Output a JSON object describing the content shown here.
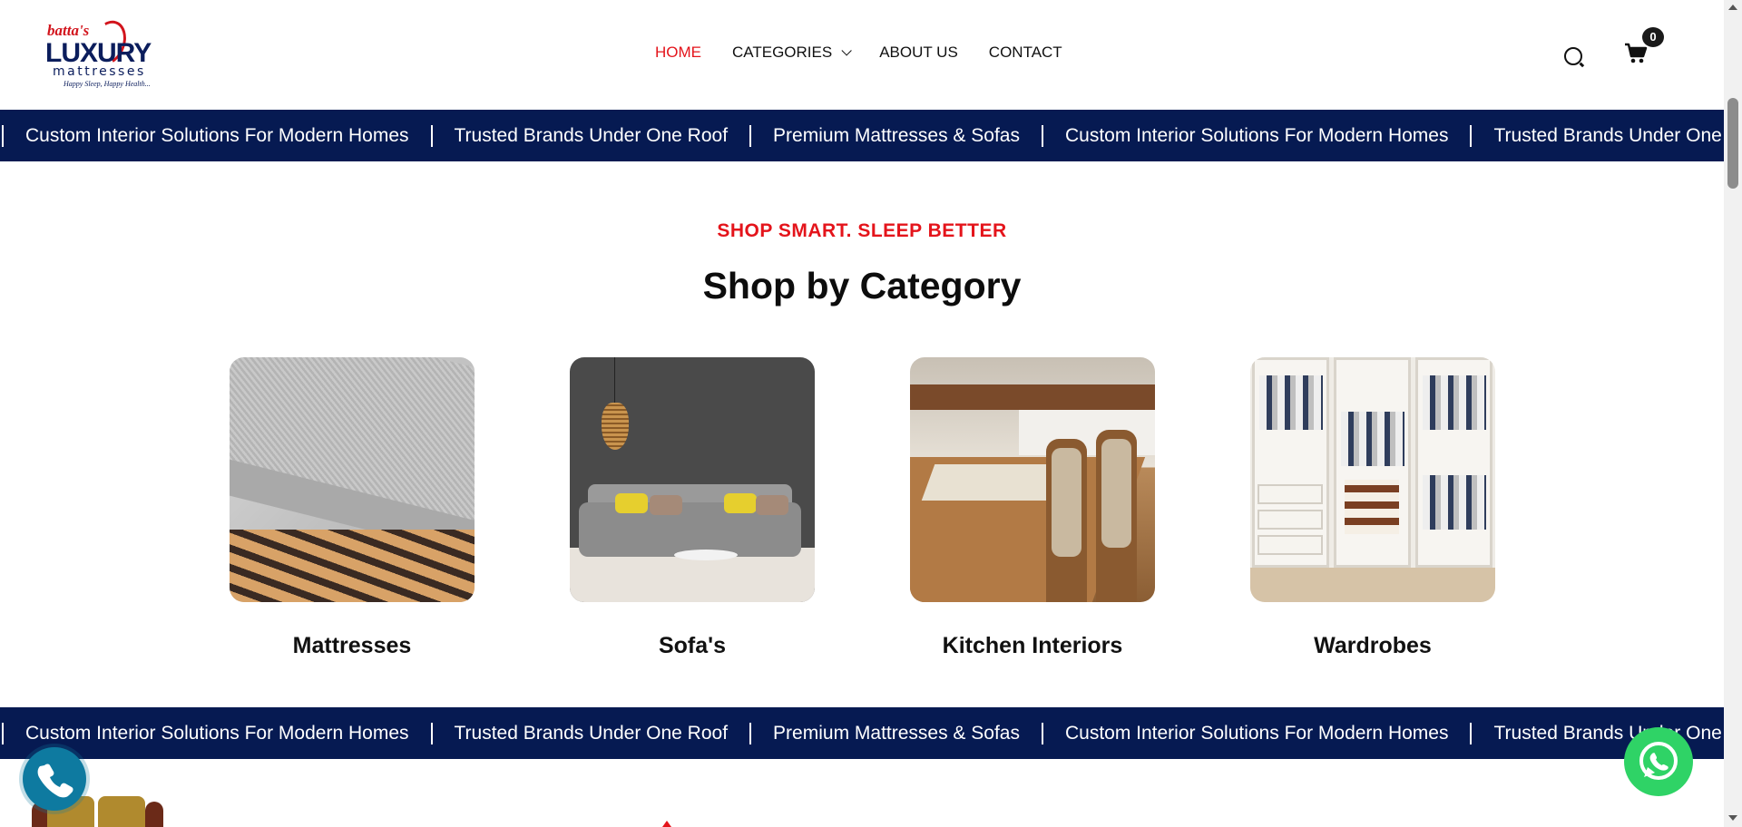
{
  "header": {
    "logo": {
      "line1": "batta's",
      "line2": "LUXURY",
      "line3": "mattresses",
      "tagline": "Happy Sleep, Happy Health..."
    },
    "nav": [
      {
        "label": "HOME",
        "active": true
      },
      {
        "label": "CATEGORIES",
        "has_dropdown": true
      },
      {
        "label": "ABOUT US"
      },
      {
        "label": "CONTACT"
      }
    ],
    "cart_count": "0",
    "icons": [
      "search-icon",
      "cart-icon"
    ]
  },
  "ticker": {
    "items": [
      "Custom Interior Solutions For Modern Homes",
      "Trusted Brands Under One Roof",
      "Premium Mattresses & Sofas",
      "Custom Interior Solutions For Modern Homes",
      "Trusted Brands Under One Roof"
    ]
  },
  "category_section": {
    "kicker": "SHOP SMART. SLEEP BETTER",
    "title": "Shop by Category",
    "categories": [
      {
        "label": "Mattresses"
      },
      {
        "label": "Sofa's"
      },
      {
        "label": "Kitchen Interiors"
      },
      {
        "label": "Wardrobes"
      }
    ]
  },
  "floating": {
    "call_icon": "phone-icon",
    "whatsapp_icon": "whatsapp-icon"
  },
  "colors": {
    "accent_red": "#e4141b",
    "navy": "#061a52",
    "call_blue": "#0e7aa0",
    "whatsapp_green": "#2fd366"
  }
}
